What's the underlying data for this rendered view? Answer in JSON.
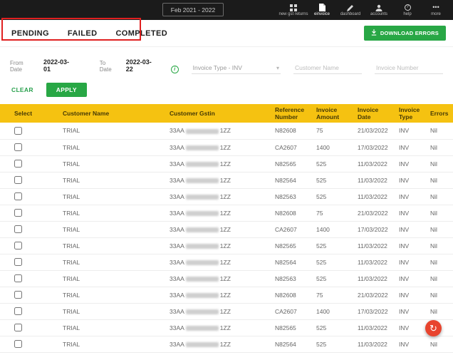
{
  "topbar": {
    "date_range": "Feb 2021 - 2022",
    "nav": [
      {
        "label": "new gst returns"
      },
      {
        "label": "einvoice"
      },
      {
        "label": "dashboard"
      },
      {
        "label": "accounts"
      },
      {
        "label": "help"
      },
      {
        "label": "more"
      }
    ]
  },
  "tabs": {
    "pending": "PENDING",
    "failed": "FAILED",
    "completed": "COMPLETED"
  },
  "toolbar": {
    "download_errors_label": "DOWNLOAD ERRORS"
  },
  "filters": {
    "from_date_label": "From Date",
    "from_date_value": "2022-03-01",
    "to_date_label": "To Date",
    "to_date_value": "2022-03-22",
    "invoice_type_value": "Invoice Type - INV",
    "customer_name_placeholder": "Customer Name",
    "invoice_number_placeholder": "Invoice Number",
    "clear_label": "CLEAR",
    "apply_label": "APPLY"
  },
  "table": {
    "headers": [
      "Select",
      "Customer Name",
      "Customer Gstin",
      "Reference Number",
      "Invoice Amount",
      "Invoice Date",
      "Invoice Type",
      "Errors"
    ],
    "gstin_prefix": "33AA",
    "gstin_suffix": "1ZZ",
    "rows": [
      {
        "customer": "TRIAL",
        "ref": "N82608",
        "amount": "75",
        "date": "21/03/2022",
        "type": "INV",
        "errors": "Nil"
      },
      {
        "customer": "TRIAL",
        "ref": "CA2607",
        "amount": "1400",
        "date": "17/03/2022",
        "type": "INV",
        "errors": "Nil"
      },
      {
        "customer": "TRIAL",
        "ref": "N82565",
        "amount": "525",
        "date": "11/03/2022",
        "type": "INV",
        "errors": "Nil"
      },
      {
        "customer": "TRIAL",
        "ref": "N82564",
        "amount": "525",
        "date": "11/03/2022",
        "type": "INV",
        "errors": "Nil"
      },
      {
        "customer": "TRIAL",
        "ref": "N82563",
        "amount": "525",
        "date": "11/03/2022",
        "type": "INV",
        "errors": "Nil"
      },
      {
        "customer": "TRIAL",
        "ref": "N82608",
        "amount": "75",
        "date": "21/03/2022",
        "type": "INV",
        "errors": "Nil"
      },
      {
        "customer": "TRIAL",
        "ref": "CA2607",
        "amount": "1400",
        "date": "17/03/2022",
        "type": "INV",
        "errors": "Nil"
      },
      {
        "customer": "TRIAL",
        "ref": "N82565",
        "amount": "525",
        "date": "11/03/2022",
        "type": "INV",
        "errors": "Nil"
      },
      {
        "customer": "TRIAL",
        "ref": "N82564",
        "amount": "525",
        "date": "11/03/2022",
        "type": "INV",
        "errors": "Nil"
      },
      {
        "customer": "TRIAL",
        "ref": "N82563",
        "amount": "525",
        "date": "11/03/2022",
        "type": "INV",
        "errors": "Nil"
      },
      {
        "customer": "TRIAL",
        "ref": "N82608",
        "amount": "75",
        "date": "21/03/2022",
        "type": "INV",
        "errors": "Nil"
      },
      {
        "customer": "TRIAL",
        "ref": "CA2607",
        "amount": "1400",
        "date": "17/03/2022",
        "type": "INV",
        "errors": "Nil"
      },
      {
        "customer": "TRIAL",
        "ref": "N82565",
        "amount": "525",
        "date": "11/03/2022",
        "type": "INV",
        "errors": "Nil"
      },
      {
        "customer": "TRIAL",
        "ref": "N82564",
        "amount": "525",
        "date": "11/03/2022",
        "type": "INV",
        "errors": "Nil"
      }
    ]
  },
  "colors": {
    "accent_green": "#28a745",
    "table_header_yellow": "#F5C211",
    "topbar_black": "#1b1b1b",
    "annotation_red": "#e02020",
    "fab_red": "#e8442e"
  }
}
